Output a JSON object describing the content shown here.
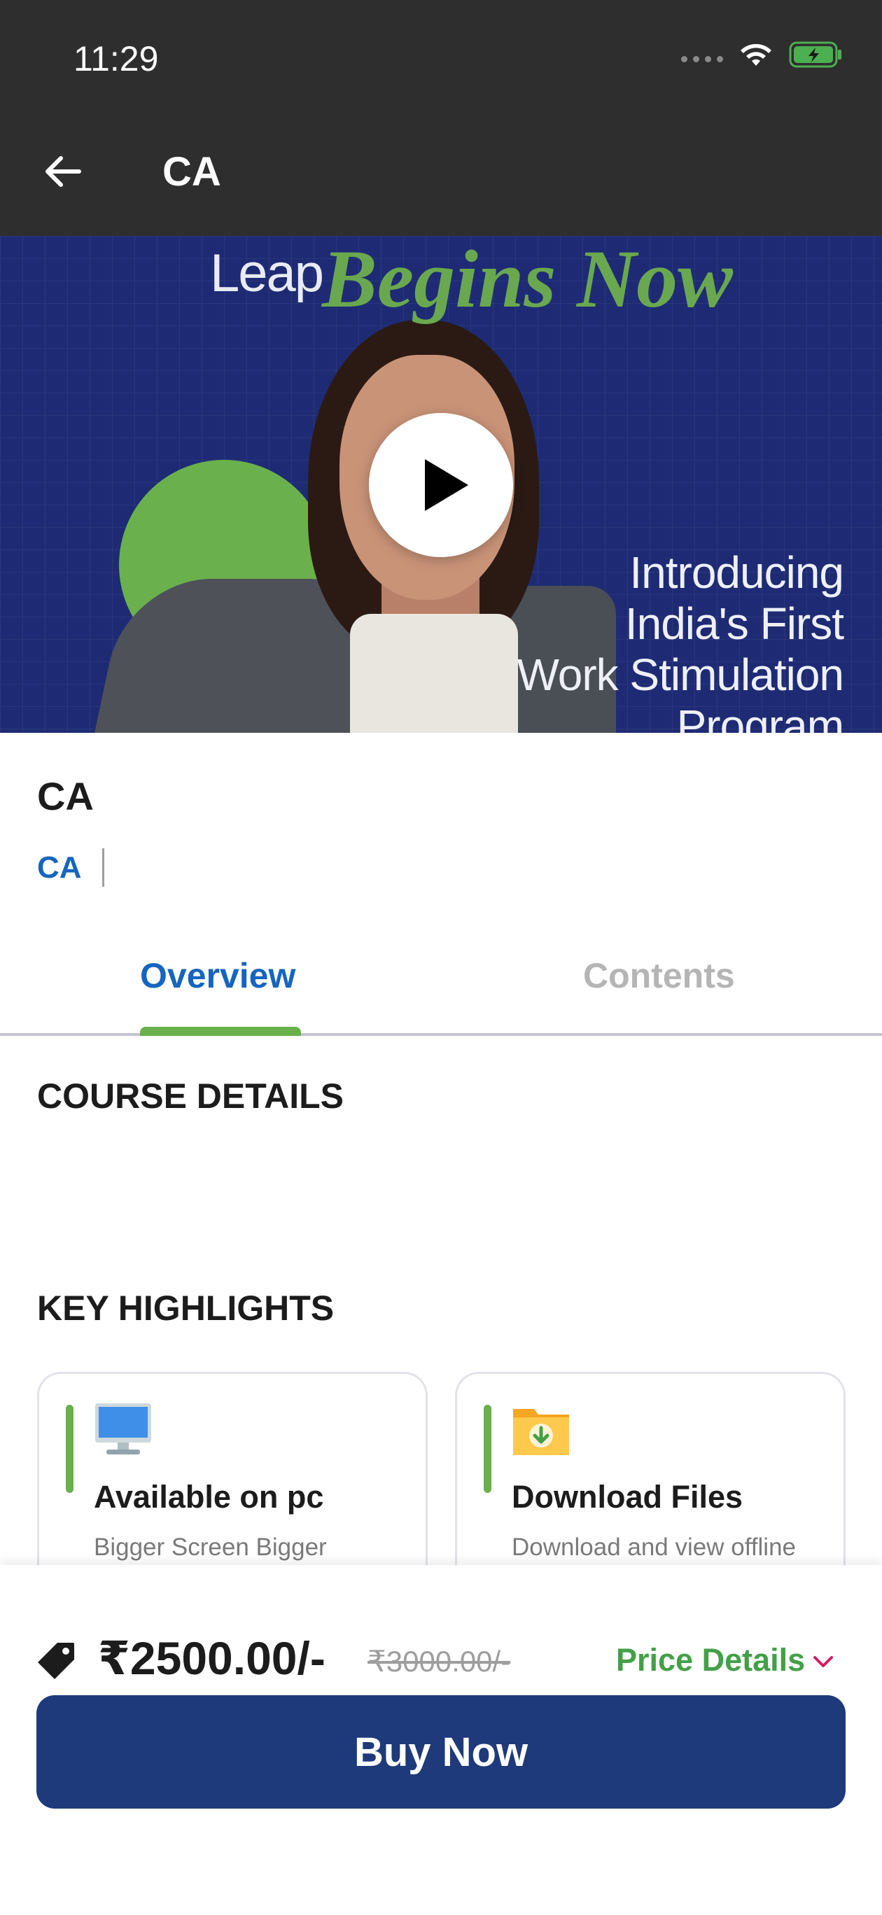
{
  "status_bar": {
    "time": "11:29"
  },
  "app_bar": {
    "title": "CA"
  },
  "hero": {
    "headline_leap": "Leap",
    "headline_main": "Begins Now",
    "intro_lines": [
      "Introducing",
      "India's First",
      "Work Stimulation",
      "Program"
    ]
  },
  "course": {
    "title": "CA",
    "category": "CA"
  },
  "tabs": [
    {
      "label": "Overview",
      "active": true
    },
    {
      "label": "Contents",
      "active": false
    }
  ],
  "sections": {
    "course_details": "COURSE DETAILS",
    "key_highlights": "KEY HIGHLIGHTS"
  },
  "highlights": [
    {
      "icon": "monitor-icon",
      "title": "Available on pc",
      "subtitle": "Bigger Screen Bigger"
    },
    {
      "icon": "download-folder-icon",
      "title": "Download Files",
      "subtitle": "Download and view offline"
    }
  ],
  "pricing": {
    "price": "₹2500.00/-",
    "original_price": "₹3000.00/-",
    "details_label": "Price Details"
  },
  "cta": {
    "buy_label": "Buy Now"
  },
  "colors": {
    "primary": "#1565c0",
    "accent_green": "#6ab04c",
    "button": "#1e3a7a",
    "top_bar": "#2e2e2e",
    "hero_bg": "#1e2b74"
  }
}
